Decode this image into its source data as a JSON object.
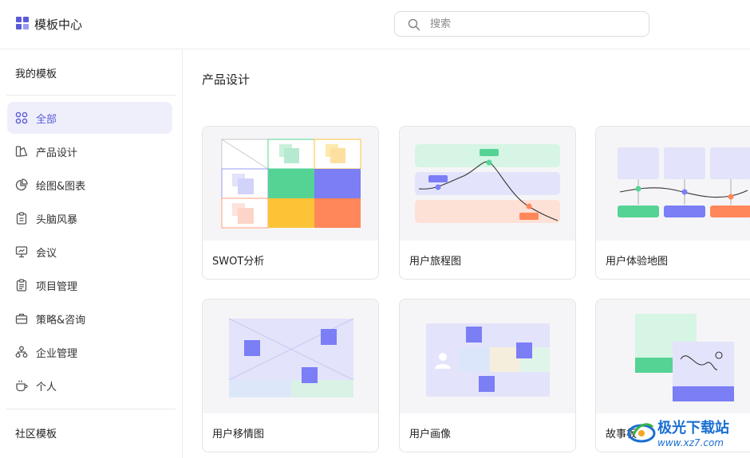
{
  "header": {
    "title": "模板中心",
    "search_placeholder": "搜索"
  },
  "sidebar": {
    "my_templates": "我的模板",
    "community_templates": "社区模板",
    "items": [
      {
        "label": "全部",
        "icon": "grid-icon",
        "active": true
      },
      {
        "label": "产品设计",
        "icon": "product-design-icon"
      },
      {
        "label": "绘图&图表",
        "icon": "pie-chart-icon"
      },
      {
        "label": "头脑风暴",
        "icon": "clipboard-icon"
      },
      {
        "label": "会议",
        "icon": "presentation-icon"
      },
      {
        "label": "项目管理",
        "icon": "clipboard-list-icon"
      },
      {
        "label": "策略&咨询",
        "icon": "briefcase-icon"
      },
      {
        "label": "企业管理",
        "icon": "org-chart-icon"
      },
      {
        "label": "个人",
        "icon": "coffee-cup-icon"
      }
    ]
  },
  "main": {
    "section_title": "产品设计",
    "cards": [
      {
        "name": "SWOT分析"
      },
      {
        "name": "用户旅程图"
      },
      {
        "name": "用户体验地图"
      },
      {
        "name": "用户移情图"
      },
      {
        "name": "用户画像"
      },
      {
        "name": "故事板"
      }
    ]
  },
  "watermark": {
    "cn": "极光下载站",
    "url": "www.xz7.com"
  },
  "colors": {
    "accent": "#5b5bd6",
    "active_bg": "#efeffc",
    "green": "#55d394",
    "purple": "#7b7ef5",
    "yellow": "#fdc337",
    "orange": "#ff875a"
  }
}
